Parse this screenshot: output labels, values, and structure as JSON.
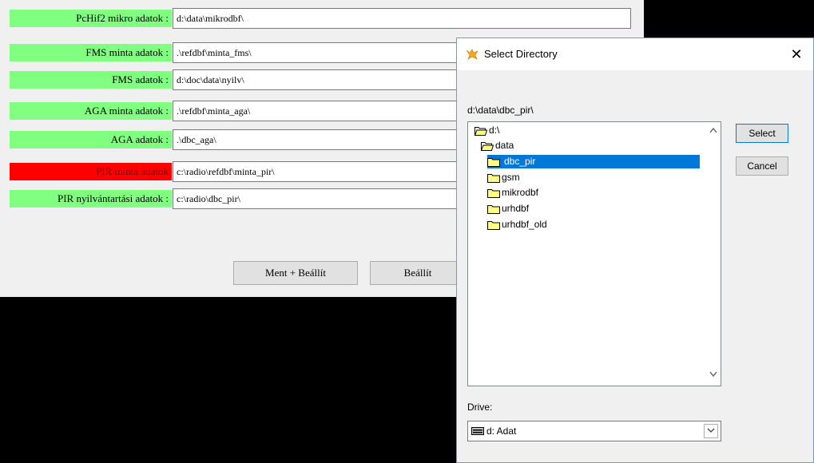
{
  "form": {
    "fields": [
      {
        "label": "PcHif2 mikro adatok :",
        "value": "d:\\data\\mikrodbf\\"
      },
      {
        "label": "FMS minta adatok :",
        "value": ".\\refdbf\\minta_fms\\"
      },
      {
        "label": "FMS adatok :",
        "value": "d:\\doc\\data\\nyilv\\"
      },
      {
        "label": "AGA minta adatok :",
        "value": ".\\refdbf\\minta_aga\\"
      },
      {
        "label": "AGA adatok :",
        "value": ".\\dbc_aga\\"
      },
      {
        "label": "PIR minta adatok",
        "value": "c:\\radio\\refdbf\\minta_pir\\"
      },
      {
        "label": "PIR nyilvántartási adatok :",
        "value": "c:\\radio\\dbc_pir\\"
      }
    ],
    "buttons": {
      "save_apply": "Ment + Beállít",
      "apply": "Beállít"
    }
  },
  "dialog": {
    "title": "Select Directory",
    "close": "✕",
    "current_path": "d:\\data\\dbc_pir\\",
    "tree": [
      {
        "label": "d:\\",
        "level": 0,
        "state": "open"
      },
      {
        "label": "data",
        "level": 1,
        "state": "open"
      },
      {
        "label": "dbc_pir",
        "level": 2,
        "state": "selected"
      },
      {
        "label": "gsm",
        "level": 2,
        "state": "closed"
      },
      {
        "label": "mikrodbf",
        "level": 2,
        "state": "closed"
      },
      {
        "label": "urhdbf",
        "level": 2,
        "state": "closed"
      },
      {
        "label": "urhdbf_old",
        "level": 2,
        "state": "closed"
      }
    ],
    "buttons": {
      "select": "Select",
      "cancel": "Cancel"
    },
    "drive_label": "Drive:",
    "drive_value": "d: Adat"
  },
  "colors": {
    "label_green": "#80ff80",
    "label_red": "#ff0000",
    "selection": "#0078d7"
  }
}
